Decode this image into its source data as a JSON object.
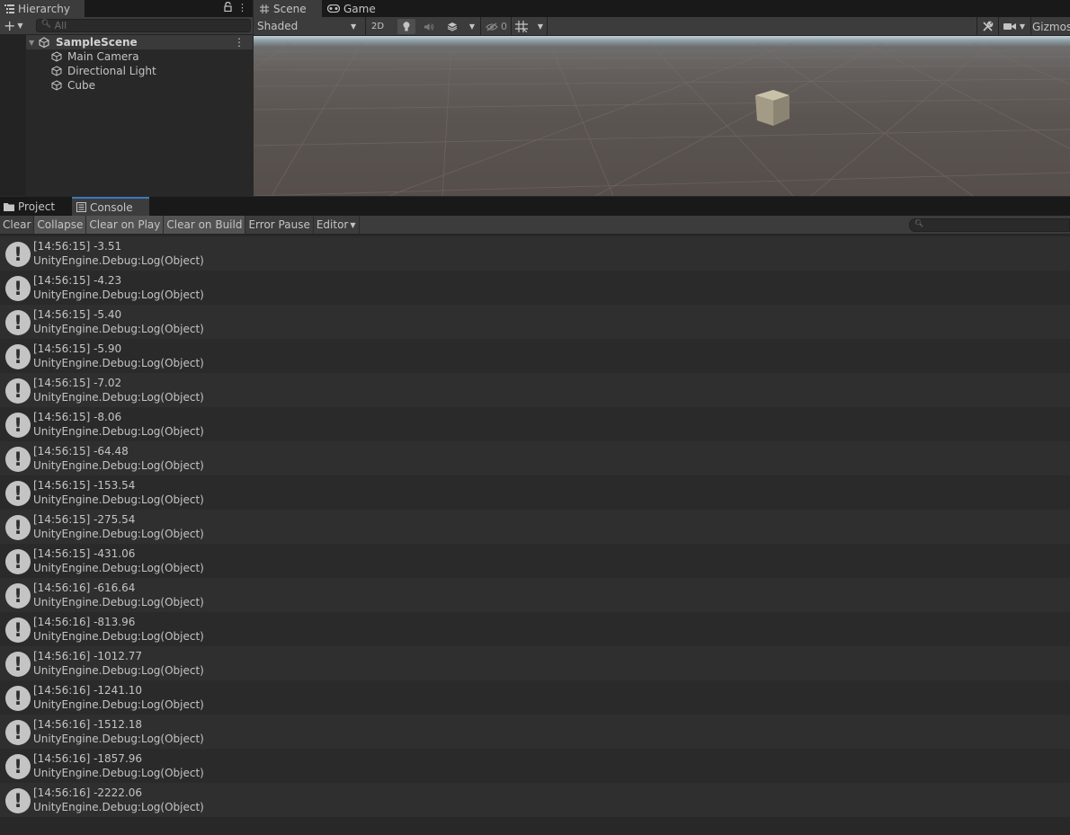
{
  "hierarchy": {
    "tab_label": "Hierarchy",
    "search_placeholder": "All",
    "scene_name": "SampleScene",
    "objects": [
      "Main Camera",
      "Directional Light",
      "Cube"
    ]
  },
  "scene_view": {
    "tabs": [
      "Scene",
      "Game"
    ],
    "draw_mode": "Shaded",
    "mode_2d_label": "2D",
    "hidden_count": "0",
    "gizmos_label": "Gizmos"
  },
  "console": {
    "tabs": [
      "Project",
      "Console"
    ],
    "toolbar": {
      "clear": "Clear",
      "collapse": "Collapse",
      "clear_on_play": "Clear on Play",
      "clear_on_build": "Clear on Build",
      "error_pause": "Error Pause",
      "editor": "Editor"
    },
    "source_line": "UnityEngine.Debug:Log(Object)",
    "logs": [
      "[14:56:15] -3.51",
      "[14:56:15] -4.23",
      "[14:56:15] -5.40",
      "[14:56:15] -5.90",
      "[14:56:15] -7.02",
      "[14:56:15] -8.06",
      "[14:56:15] -64.48",
      "[14:56:15] -153.54",
      "[14:56:15] -275.54",
      "[14:56:15] -431.06",
      "[14:56:16] -616.64",
      "[14:56:16] -813.96",
      "[14:56:16] -1012.77",
      "[14:56:16] -1241.10",
      "[14:56:16] -1512.18",
      "[14:56:16] -1857.96",
      "[14:56:16] -2222.06"
    ]
  },
  "colors": {
    "panel_bg": "#282828",
    "toolbar_bg": "#3c3c3c",
    "tab_strip_bg": "#191919",
    "active_tab_accent": "#3a79bb",
    "text": "#c4c4c4"
  }
}
